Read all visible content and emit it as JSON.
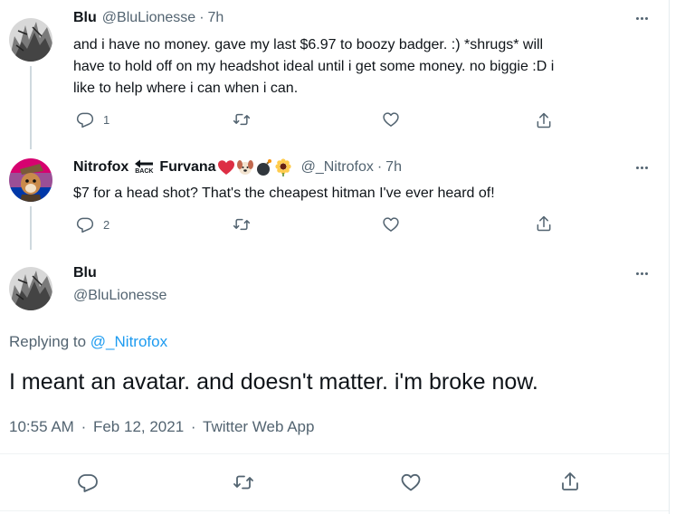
{
  "tweets": [
    {
      "name": "Blu",
      "handle": "@BluLionesse",
      "dot": "·",
      "time": "7h",
      "lines": [
        "and i have no money. gave my last $6.97 to boozy badger. :) *shrugs* will",
        "have to hold off on my headshot ideal until i get some money. no biggie :D i",
        "like to help where i can when i can."
      ],
      "reply_count": "1"
    },
    {
      "name": "Nitrofox",
      "back_label": "BACK",
      "name2": "Furvana",
      "handle": "@_Nitrofox",
      "dot": "·",
      "time": "7h",
      "text": "$7 for a head shot? That's the cheapest hitman I've ever heard of!",
      "reply_count": "2"
    }
  ],
  "main_tweet": {
    "name": "Blu",
    "handle": "@BluLionesse",
    "replying_prefix": "Replying to",
    "replying_to": "@_Nitrofox",
    "text": "I meant an avatar. and doesn't matter. i'm broke now.",
    "timestamp": "10:55 AM",
    "dot1": "·",
    "date": "Feb 12, 2021",
    "dot2": "·",
    "source": "Twitter Web App"
  },
  "icons": {
    "reply": "reply-icon",
    "retweet": "retweet-icon",
    "like": "heart-icon",
    "share": "share-icon",
    "more": "more-icon"
  },
  "colors": {
    "text": "#0f1419",
    "secondary": "#536471",
    "link": "#1d9bf0",
    "border": "#eff3f4"
  }
}
